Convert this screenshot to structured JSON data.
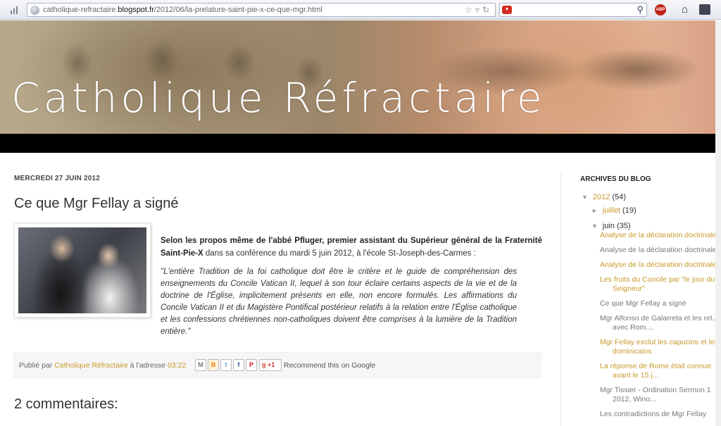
{
  "browser": {
    "url_prefix": "catholique-refractaire.",
    "url_domain": "blogspot.fr",
    "url_path": "/2012/06/la-prelature-saint-pie-x-ce-que-mgr.html",
    "abp_label": "ABP"
  },
  "banner": {
    "title": "Catholique Réfractaire"
  },
  "post": {
    "date": "MERCREDI 27 JUIN 2012",
    "title": "Ce que Mgr Fellay a signé",
    "intro_bold": "Selon les propos même de l'abbé Pfluger, premier assistant du Supérieur général de la Fraternité Saint-Pie-X",
    "intro_rest": " dans sa conférence du mardi 5 juin 2012, à l'école St-Joseph-des-Carmes :",
    "quote": "\"L'entière Tradition de la foi catholique doit être le critère et le guide de compréhension des enseignements du Concile Vatican II, lequel à son tour éclaire certains aspects de la vie et de la doctrine de l'Église, implicitement présents en elle, non encore formulés. Les affirmations du Concile Vatican II et du Magistère Pontifical postérieur relatifs à la relation entre l'Église catholique et les confessions chrétiennes non-catholiques doivent être comprises à la lumière de la Tradition entière.\""
  },
  "footer": {
    "published_by": "Publié par ",
    "author": "Catholique Réfractaire",
    "at_address": " à l'adresse ",
    "time": "03:22",
    "gplus": "+1",
    "recommend": "Recommend this on Google"
  },
  "comments": {
    "title": "2 commentaires:"
  },
  "sidebar": {
    "heading": "ARCHIVES DU BLOG",
    "year": "2012",
    "year_count": " (54)",
    "month1": "juillet",
    "month1_count": " (19)",
    "month2": "juin",
    "month2_count": " (35)",
    "posts": [
      {
        "l1": "Analyse de la déclaration doctrinale",
        "l2": ""
      },
      {
        "l1": "Analyse de la déclaration doctrinale",
        "l2": ""
      },
      {
        "l1": "Analyse de la déclaration doctrinale",
        "l2": ""
      },
      {
        "l1": "Les fruits du Concile par \"le jour du",
        "l2": "Seigneur\""
      },
      {
        "l1": "Ce que Mgr Fellay a signé",
        "l2": ""
      },
      {
        "l1": "Mgr Alfonso de Galarreta et les rel...",
        "l2": "avec Rom...."
      },
      {
        "l1": "Mgr Fellay exclut les capucins et les",
        "l2": "dominicains"
      },
      {
        "l1": "La réponse de Rome était connue",
        "l2": "avant le 15 j..."
      },
      {
        "l1": "Mgr Tissier - Ordination Sermon 1",
        "l2": "2012, Wino..."
      },
      {
        "l1": "Les contradictions de Mgr Fellay",
        "l2": ""
      }
    ]
  },
  "colors": {
    "link": "#c89a2a",
    "banner_bar": "#000000"
  }
}
